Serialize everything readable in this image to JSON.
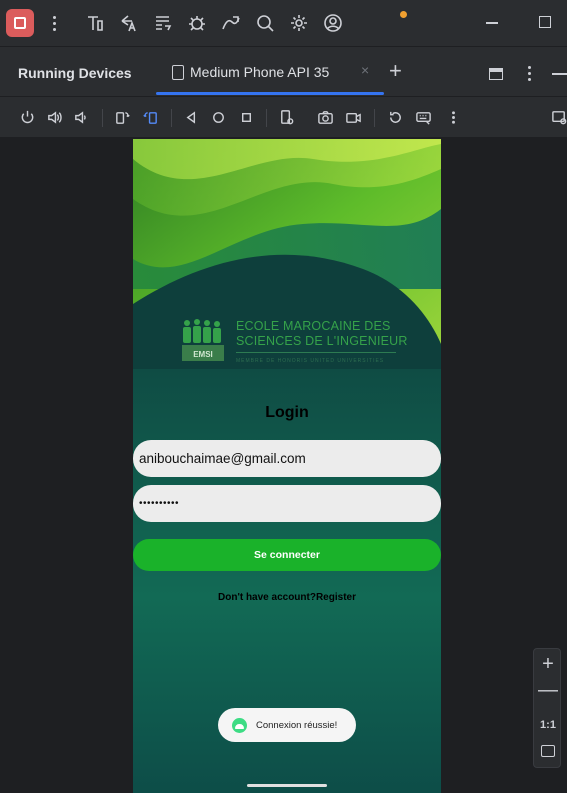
{
  "toolbar": {
    "icons": [
      "stop-icon",
      "more-icon",
      "build-icon",
      "apply-changes-icon",
      "sync-icon",
      "debug-icon",
      "profile-icon",
      "search-icon",
      "settings-icon",
      "account-icon",
      "minimize-icon",
      "maximize-icon"
    ],
    "accent": "#db5c5c"
  },
  "tabs": {
    "tool_title": "Running Devices",
    "active_tab": "Medium Phone API 35",
    "close_glyph": "×",
    "add_glyph": "+",
    "accent": "#3574f0"
  },
  "device_toolbar": {
    "icons": [
      "power-icon",
      "volume-up-icon",
      "volume-down-icon",
      "rotate-left-icon",
      "rotate-right-icon",
      "back-icon",
      "home-icon",
      "overview-icon",
      "device-state-icon",
      "screenshot-icon",
      "screen-record-icon",
      "reset-icon",
      "extended-controls-icon",
      "more-icon",
      "device-mirror-icon"
    ]
  },
  "app": {
    "logo_line1": "ECOLE MAROCAINE DES",
    "logo_line2": "SCIENCES DE L'INGENIEUR",
    "logo_badge": "EMSI",
    "logo_tagline": "MEMBRE DE HONORIS UNITED UNIVERSITIES",
    "login_title": "Login",
    "email_value": "anibouchaimae@gmail.com",
    "password_value": "••••••••••",
    "connect_label": "Se connecter",
    "register_text": "Don't have account?Register",
    "toast_text": "Connexion réussie!",
    "primary_color": "#1ab22a"
  },
  "zoom": {
    "plus": "+",
    "minus": "—",
    "one_to_one": "1:1"
  }
}
